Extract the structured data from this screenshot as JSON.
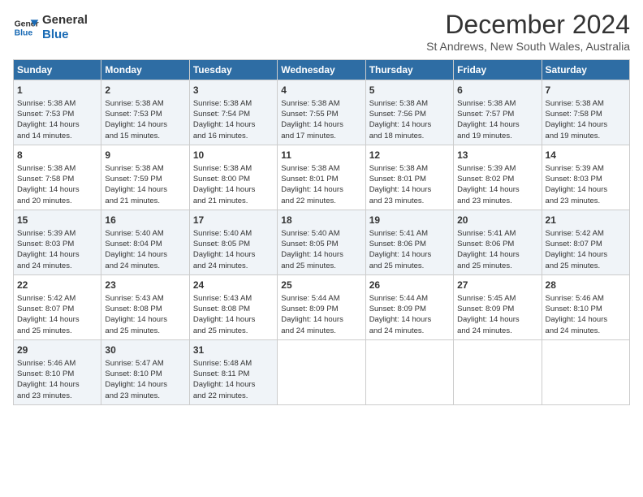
{
  "header": {
    "logo_text_general": "General",
    "logo_text_blue": "Blue",
    "month_title": "December 2024",
    "subtitle": "St Andrews, New South Wales, Australia"
  },
  "days_of_week": [
    "Sunday",
    "Monday",
    "Tuesday",
    "Wednesday",
    "Thursday",
    "Friday",
    "Saturday"
  ],
  "weeks": [
    [
      {
        "day": "1",
        "info": "Sunrise: 5:38 AM\nSunset: 7:53 PM\nDaylight: 14 hours\nand 14 minutes."
      },
      {
        "day": "2",
        "info": "Sunrise: 5:38 AM\nSunset: 7:53 PM\nDaylight: 14 hours\nand 15 minutes."
      },
      {
        "day": "3",
        "info": "Sunrise: 5:38 AM\nSunset: 7:54 PM\nDaylight: 14 hours\nand 16 minutes."
      },
      {
        "day": "4",
        "info": "Sunrise: 5:38 AM\nSunset: 7:55 PM\nDaylight: 14 hours\nand 17 minutes."
      },
      {
        "day": "5",
        "info": "Sunrise: 5:38 AM\nSunset: 7:56 PM\nDaylight: 14 hours\nand 18 minutes."
      },
      {
        "day": "6",
        "info": "Sunrise: 5:38 AM\nSunset: 7:57 PM\nDaylight: 14 hours\nand 19 minutes."
      },
      {
        "day": "7",
        "info": "Sunrise: 5:38 AM\nSunset: 7:58 PM\nDaylight: 14 hours\nand 19 minutes."
      }
    ],
    [
      {
        "day": "8",
        "info": "Sunrise: 5:38 AM\nSunset: 7:58 PM\nDaylight: 14 hours\nand 20 minutes."
      },
      {
        "day": "9",
        "info": "Sunrise: 5:38 AM\nSunset: 7:59 PM\nDaylight: 14 hours\nand 21 minutes."
      },
      {
        "day": "10",
        "info": "Sunrise: 5:38 AM\nSunset: 8:00 PM\nDaylight: 14 hours\nand 21 minutes."
      },
      {
        "day": "11",
        "info": "Sunrise: 5:38 AM\nSunset: 8:01 PM\nDaylight: 14 hours\nand 22 minutes."
      },
      {
        "day": "12",
        "info": "Sunrise: 5:38 AM\nSunset: 8:01 PM\nDaylight: 14 hours\nand 23 minutes."
      },
      {
        "day": "13",
        "info": "Sunrise: 5:39 AM\nSunset: 8:02 PM\nDaylight: 14 hours\nand 23 minutes."
      },
      {
        "day": "14",
        "info": "Sunrise: 5:39 AM\nSunset: 8:03 PM\nDaylight: 14 hours\nand 23 minutes."
      }
    ],
    [
      {
        "day": "15",
        "info": "Sunrise: 5:39 AM\nSunset: 8:03 PM\nDaylight: 14 hours\nand 24 minutes."
      },
      {
        "day": "16",
        "info": "Sunrise: 5:40 AM\nSunset: 8:04 PM\nDaylight: 14 hours\nand 24 minutes."
      },
      {
        "day": "17",
        "info": "Sunrise: 5:40 AM\nSunset: 8:05 PM\nDaylight: 14 hours\nand 24 minutes."
      },
      {
        "day": "18",
        "info": "Sunrise: 5:40 AM\nSunset: 8:05 PM\nDaylight: 14 hours\nand 25 minutes."
      },
      {
        "day": "19",
        "info": "Sunrise: 5:41 AM\nSunset: 8:06 PM\nDaylight: 14 hours\nand 25 minutes."
      },
      {
        "day": "20",
        "info": "Sunrise: 5:41 AM\nSunset: 8:06 PM\nDaylight: 14 hours\nand 25 minutes."
      },
      {
        "day": "21",
        "info": "Sunrise: 5:42 AM\nSunset: 8:07 PM\nDaylight: 14 hours\nand 25 minutes."
      }
    ],
    [
      {
        "day": "22",
        "info": "Sunrise: 5:42 AM\nSunset: 8:07 PM\nDaylight: 14 hours\nand 25 minutes."
      },
      {
        "day": "23",
        "info": "Sunrise: 5:43 AM\nSunset: 8:08 PM\nDaylight: 14 hours\nand 25 minutes."
      },
      {
        "day": "24",
        "info": "Sunrise: 5:43 AM\nSunset: 8:08 PM\nDaylight: 14 hours\nand 25 minutes."
      },
      {
        "day": "25",
        "info": "Sunrise: 5:44 AM\nSunset: 8:09 PM\nDaylight: 14 hours\nand 24 minutes."
      },
      {
        "day": "26",
        "info": "Sunrise: 5:44 AM\nSunset: 8:09 PM\nDaylight: 14 hours\nand 24 minutes."
      },
      {
        "day": "27",
        "info": "Sunrise: 5:45 AM\nSunset: 8:09 PM\nDaylight: 14 hours\nand 24 minutes."
      },
      {
        "day": "28",
        "info": "Sunrise: 5:46 AM\nSunset: 8:10 PM\nDaylight: 14 hours\nand 24 minutes."
      }
    ],
    [
      {
        "day": "29",
        "info": "Sunrise: 5:46 AM\nSunset: 8:10 PM\nDaylight: 14 hours\nand 23 minutes."
      },
      {
        "day": "30",
        "info": "Sunrise: 5:47 AM\nSunset: 8:10 PM\nDaylight: 14 hours\nand 23 minutes."
      },
      {
        "day": "31",
        "info": "Sunrise: 5:48 AM\nSunset: 8:11 PM\nDaylight: 14 hours\nand 22 minutes."
      },
      {
        "day": "",
        "info": ""
      },
      {
        "day": "",
        "info": ""
      },
      {
        "day": "",
        "info": ""
      },
      {
        "day": "",
        "info": ""
      }
    ]
  ]
}
